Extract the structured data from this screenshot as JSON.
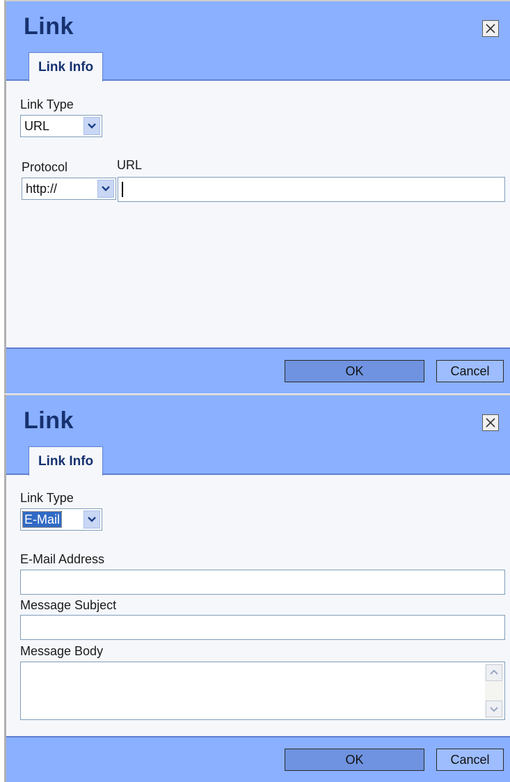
{
  "dialog_url": {
    "title": "Link",
    "tab_label": "Link Info",
    "link_type_label": "Link Type",
    "link_type_value": "URL",
    "protocol_label": "Protocol",
    "protocol_value": "http://",
    "url_label": "URL",
    "url_value": "",
    "ok_label": "OK",
    "cancel_label": "Cancel"
  },
  "dialog_email": {
    "title": "Link",
    "tab_label": "Link Info",
    "link_type_label": "Link Type",
    "link_type_value": "E-Mail",
    "email_address_label": "E-Mail Address",
    "email_address_value": "",
    "message_subject_label": "Message Subject",
    "message_subject_value": "",
    "message_body_label": "Message Body",
    "message_body_value": "",
    "ok_label": "OK",
    "cancel_label": "Cancel"
  },
  "icons": {
    "close": "close-icon",
    "dropdown": "chevron-down-icon",
    "scroll_up": "chevron-up-icon",
    "scroll_down": "chevron-down-icon"
  },
  "colors": {
    "header_bg": "#8ab0ff",
    "title_text": "#16316f",
    "body_bg": "#f5f7fb",
    "ok_button": "#6f93e0",
    "cancel_button": "#9dbdff",
    "selection": "#316ac5"
  }
}
